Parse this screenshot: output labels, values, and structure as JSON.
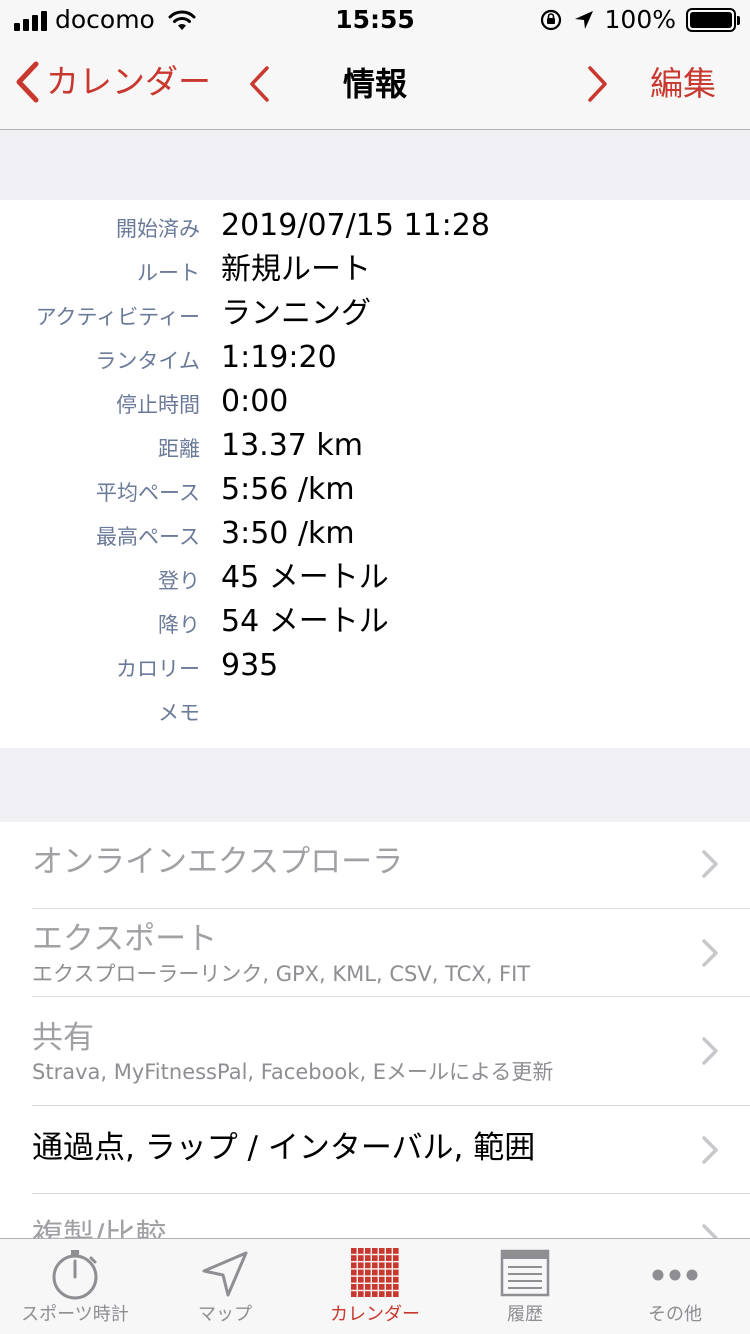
{
  "status_bar": {
    "carrier": "docomo",
    "time": "15:55",
    "battery": "100%"
  },
  "nav": {
    "back_label": "カレンダー",
    "title": "情報",
    "edit_label": "編集"
  },
  "info_rows": [
    {
      "key": "開始済み",
      "value": "2019/07/15 11:28"
    },
    {
      "key": "ルート",
      "value": "新規ルート"
    },
    {
      "key": "アクティビティー",
      "value": "ランニング"
    },
    {
      "key": "ランタイム",
      "value": "1:19:20"
    },
    {
      "key": "停止時間",
      "value": "0:00"
    },
    {
      "key": "距離",
      "value": "13.37 km"
    },
    {
      "key": "平均ペース",
      "value": "5:56 /km"
    },
    {
      "key": "最高ペース",
      "value": "3:50 /km"
    },
    {
      "key": "登り",
      "value": "45 メートル"
    },
    {
      "key": "降り",
      "value": "54 メートル"
    },
    {
      "key": "カロリー",
      "value": "935"
    },
    {
      "key": "メモ",
      "value": ""
    }
  ],
  "list": {
    "online_explorer": "オンラインエクスプローラ",
    "export": {
      "title": "エクスポート",
      "sub": "エクスプローラーリンク, GPX, KML, CSV, TCX, FIT"
    },
    "share": {
      "title": "共有",
      "sub": "Strava, MyFitnessPal, Facebook, Eメールによる更新"
    },
    "splits": "通過点, ラップ / インターバル, 範囲",
    "copy_compare": "複製/比較"
  },
  "tabs": [
    {
      "label": "スポーツ時計",
      "icon": "stopwatch-icon"
    },
    {
      "label": "マップ",
      "icon": "map-arrow-icon"
    },
    {
      "label": "カレンダー",
      "icon": "calendar-grid-icon"
    },
    {
      "label": "履歴",
      "icon": "history-list-icon"
    },
    {
      "label": "その他",
      "icon": "more-dots-icon"
    }
  ],
  "colors": {
    "accent": "#c8382e",
    "label_blue": "#6b7a99",
    "background": "#efeff4"
  }
}
